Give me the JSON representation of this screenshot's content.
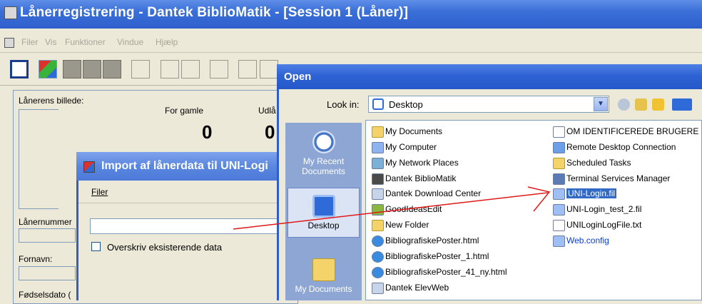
{
  "main_window": {
    "title": "Lånerregistrering - Dantek BiblioMatik - [Session 1 (Låner)]",
    "menu": [
      "Filer",
      "Vis",
      "Funktioner",
      "Vindue",
      "Hjælp"
    ]
  },
  "panel": {
    "photo_label": "Lånerens billede:",
    "col1_label": "For gamle",
    "col2_label": "Udlå",
    "col1_value": "0",
    "col2_value": "0",
    "field_labels": [
      "Lånernummer",
      "Fornavn:",
      "Fødselsdato ("
    ]
  },
  "import_dialog": {
    "title": "Import af lånerdata til UNI-Logi",
    "menu_label": "Filer",
    "input_value": "",
    "checkbox_label": "Overskriv eksisterende data",
    "checkbox_checked": false
  },
  "open_dialog": {
    "title": "Open",
    "look_in_label": "Look in:",
    "look_in_value": "Desktop",
    "places": [
      {
        "label": "My Recent Documents",
        "icon": "recent-documents-icon"
      },
      {
        "label": "Desktop",
        "icon": "desktop-icon",
        "selected": true
      },
      {
        "label": "My Documents",
        "icon": "my-documents-icon"
      }
    ],
    "files_col1": [
      "My Documents",
      "My Computer",
      "My Network Places",
      "Dantek BiblioMatik",
      "Dantek Download Center",
      "GoodIdeasEdit",
      "New Folder",
      "BibliografiskePoster.html",
      "BibliografiskePoster_1.html",
      "BibliografiskePoster_41_ny.html",
      "Dantek ElevWeb"
    ],
    "files_col2": [
      "OM IDENTIFICEREDE BRUGERE",
      "Remote Desktop Connection",
      "Scheduled Tasks",
      "Terminal Services Manager",
      "UNI-Login.fil",
      "UNI-Login_test_2.fil",
      "UNILoginLogFile.txt",
      "Web.config"
    ],
    "selected_file": "UNI-Login.fil"
  },
  "colors": {
    "titlebar_blue": "#2f5fcd",
    "selection_blue": "#316ac5",
    "annotation_arrow": "#e01818"
  }
}
